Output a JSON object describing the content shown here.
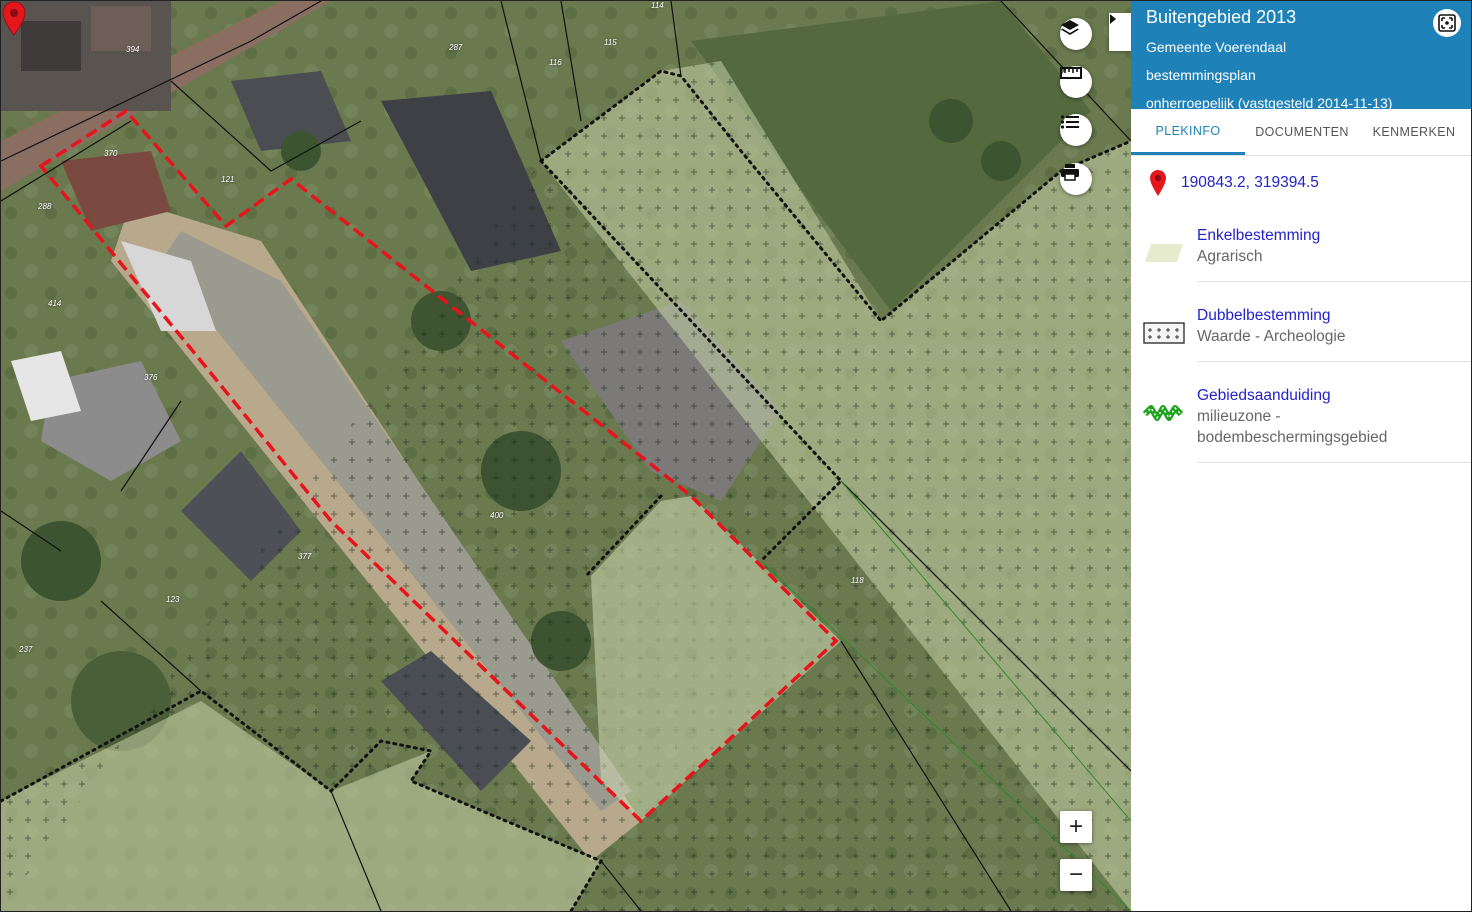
{
  "panel": {
    "title": "Buitengebied 2013",
    "subtitle_lines": [
      "Gemeente Voerendaal",
      "bestemmingsplan",
      "onherroepelijk (vastgesteld 2014-11-13)"
    ],
    "tabs": [
      "PLEKINFO",
      "DOCUMENTEN",
      "KENMERKEN"
    ],
    "active_tab": "PLEKINFO",
    "coordinates": "190843.2, 319394.5",
    "legend": [
      {
        "type": "Enkelbestemming",
        "value": "Agrarisch",
        "icon": "agrarisch-swatch"
      },
      {
        "type": "Dubbelbestemming",
        "value": "Waarde - Archeologie",
        "icon": "archeologie-cross-pattern"
      },
      {
        "type": "Gebiedsaanduiding",
        "value": "milieuzone - bodembeschermingsgebied",
        "icon": "milieuzone-zigzag"
      }
    ]
  },
  "map": {
    "parcel_numbers": [
      "394",
      "287",
      "114",
      "116",
      "115",
      "370",
      "121",
      "288",
      "414",
      "376",
      "400",
      "377",
      "118",
      "123",
      "237"
    ],
    "zoom_in_label": "+",
    "zoom_out_label": "−",
    "tools": [
      "layers-icon",
      "ruler-icon",
      "list-icon",
      "print-icon"
    ],
    "colors": {
      "selection": "#e8131b",
      "pin": "#e4171d",
      "zone_boundary": "#111111",
      "header": "#1e82b9",
      "link": "#2222cc"
    }
  }
}
